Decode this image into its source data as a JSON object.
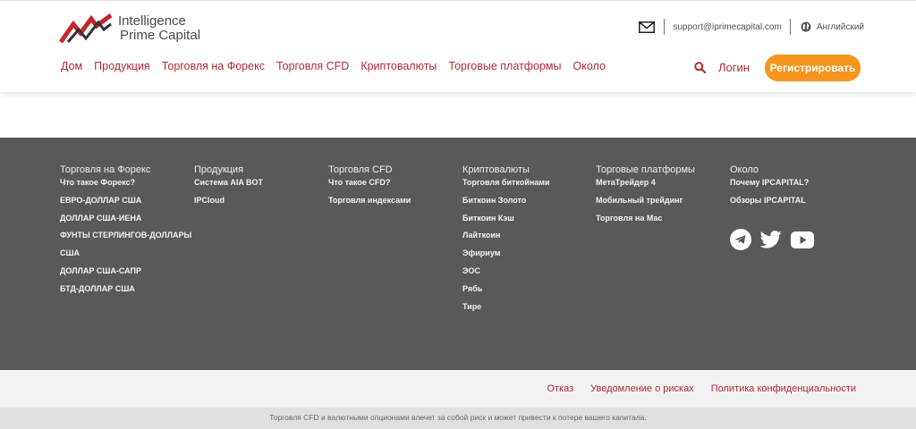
{
  "brand": {
    "line1": "Intelligence",
    "line2": "Prime Capital",
    "colors": {
      "logo_red": "#c9252d",
      "logo_dark": "#333333"
    }
  },
  "topbar": {
    "email": "support@iprimecapital.com",
    "language": "Английский",
    "icons": {
      "mail": "mail-icon",
      "language": "globe-icon"
    }
  },
  "nav": {
    "items": [
      "Дом",
      "Продукция",
      "Торговля на Форекс",
      "Торговля CFD",
      "Криптовалюты",
      "Торговые платформы",
      "Около"
    ],
    "login": "Логин",
    "register": "Регистрировать",
    "icons": {
      "search": "search-icon"
    }
  },
  "footer": {
    "columns": [
      {
        "title": "Торговля на Форекс",
        "links": [
          "Что такое Форекс?",
          "ЕВРО-ДОЛЛАР США",
          "ДОЛЛАР США-ИЕНА",
          "ФУНТЫ СТЕРЛИНГОВ-ДОЛЛАРЫ",
          "США",
          "ДОЛЛАР США-САПР",
          "БТД-ДОЛЛАР США"
        ]
      },
      {
        "title": "Продукция",
        "links": [
          "Система AIA BOT",
          "IPCloud"
        ]
      },
      {
        "title": "Торговля CFD",
        "links": [
          "Что такое CFD?",
          "Торговля индексами"
        ]
      },
      {
        "title": "Криптовалюты",
        "links": [
          "Торговля биткойнами",
          "Биткоин Золото",
          "Биткоин Кэш",
          "Лайткоин",
          "Эфириум",
          "ЭОС",
          "Рябь",
          "Тире"
        ]
      },
      {
        "title": "Торговые платформы",
        "links": [
          "МетаТрейдер 4",
          "Мобильный трейдинг",
          "Торговля на Mac"
        ]
      },
      {
        "title": "Около",
        "links": [
          "Почему IPCAPITAL?",
          "Обзоры IPCAPITAL"
        ]
      }
    ],
    "social_icons": [
      "telegram-icon",
      "twitter-icon",
      "youtube-icon"
    ]
  },
  "legal": {
    "links": [
      "Отказ",
      "Уведомление о рисках",
      "Политика конфиденциальности"
    ],
    "disclaimer": "Торговля CFD и валютными опционами влечет за собой риск и может привести к потере вашего капитала."
  },
  "colors": {
    "accent": "#b22b35",
    "button": "#f7941d",
    "footer_bg": "#595959",
    "bottom_bg": "#f2f2f2",
    "disclaimer_bg": "#e0e0e0"
  }
}
